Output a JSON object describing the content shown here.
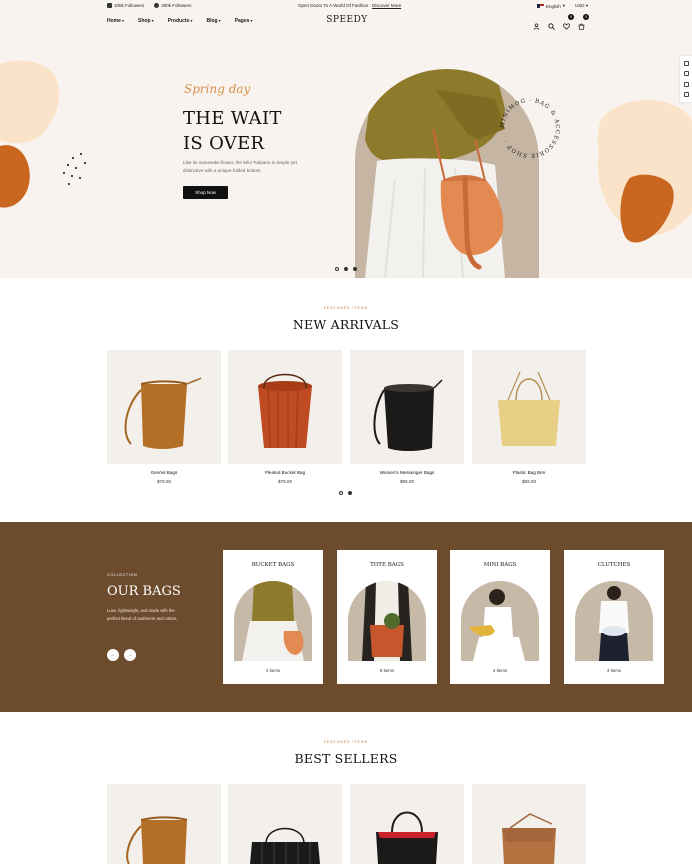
{
  "topbar": {
    "followers_1": "100k Followers",
    "followers_2": "300k Followers",
    "announcement": "Open Doors To A World Of Fashion",
    "announcement_link": "Discover More",
    "language": "English",
    "currency": "USD"
  },
  "header": {
    "nav": [
      "Home",
      "Shop",
      "Products",
      "Blog",
      "Pages"
    ],
    "logo": "SPEEDY",
    "wishlist_count": "0",
    "cart_count": "0"
  },
  "hero": {
    "tagline": "Spring day",
    "title_line1": "THE WAIT",
    "title_line2": "IS OVER",
    "description": "Like its namesake flower, the Mini Tulipano is simple yet distinctive with a unique folded bottom",
    "cta": "Shop Now",
    "circle_text": "MINIMOG · BAG & ACCESSORIE SHOP ·"
  },
  "new_arrivals": {
    "eyebrow": "FEATURED ITEMS",
    "title": "NEW ARRIVALS",
    "products": [
      {
        "name": "Genriel Bags",
        "price": "$79.00"
      },
      {
        "name": "Pleated Bucket Bag",
        "price": "$79.00"
      },
      {
        "name": "Women's Messenger Bags",
        "price": "$95.00"
      },
      {
        "name": "Plastic Bag Ben",
        "price": "$59.00"
      }
    ]
  },
  "collection": {
    "eyebrow": "COLLECTION",
    "title": "OUR BAGS",
    "description": "Luxe, lightweight, and made with the perfect blend of cashmere and cotton,",
    "categories": [
      {
        "name": "BUCKET BAGS",
        "count": "4 items"
      },
      {
        "name": "TOTE BAGS",
        "count": "9 items"
      },
      {
        "name": "MINI BAGS",
        "count": "4 items"
      },
      {
        "name": "CLUTCHES",
        "count": "3 items"
      }
    ]
  },
  "best_sellers": {
    "eyebrow": "FEATURED ITEMS",
    "title": "BEST SELLERS"
  },
  "colors": {
    "accent": "#c17a3d",
    "brown_section": "#6d4c2d",
    "hero_bg": "#f8f3ee"
  }
}
